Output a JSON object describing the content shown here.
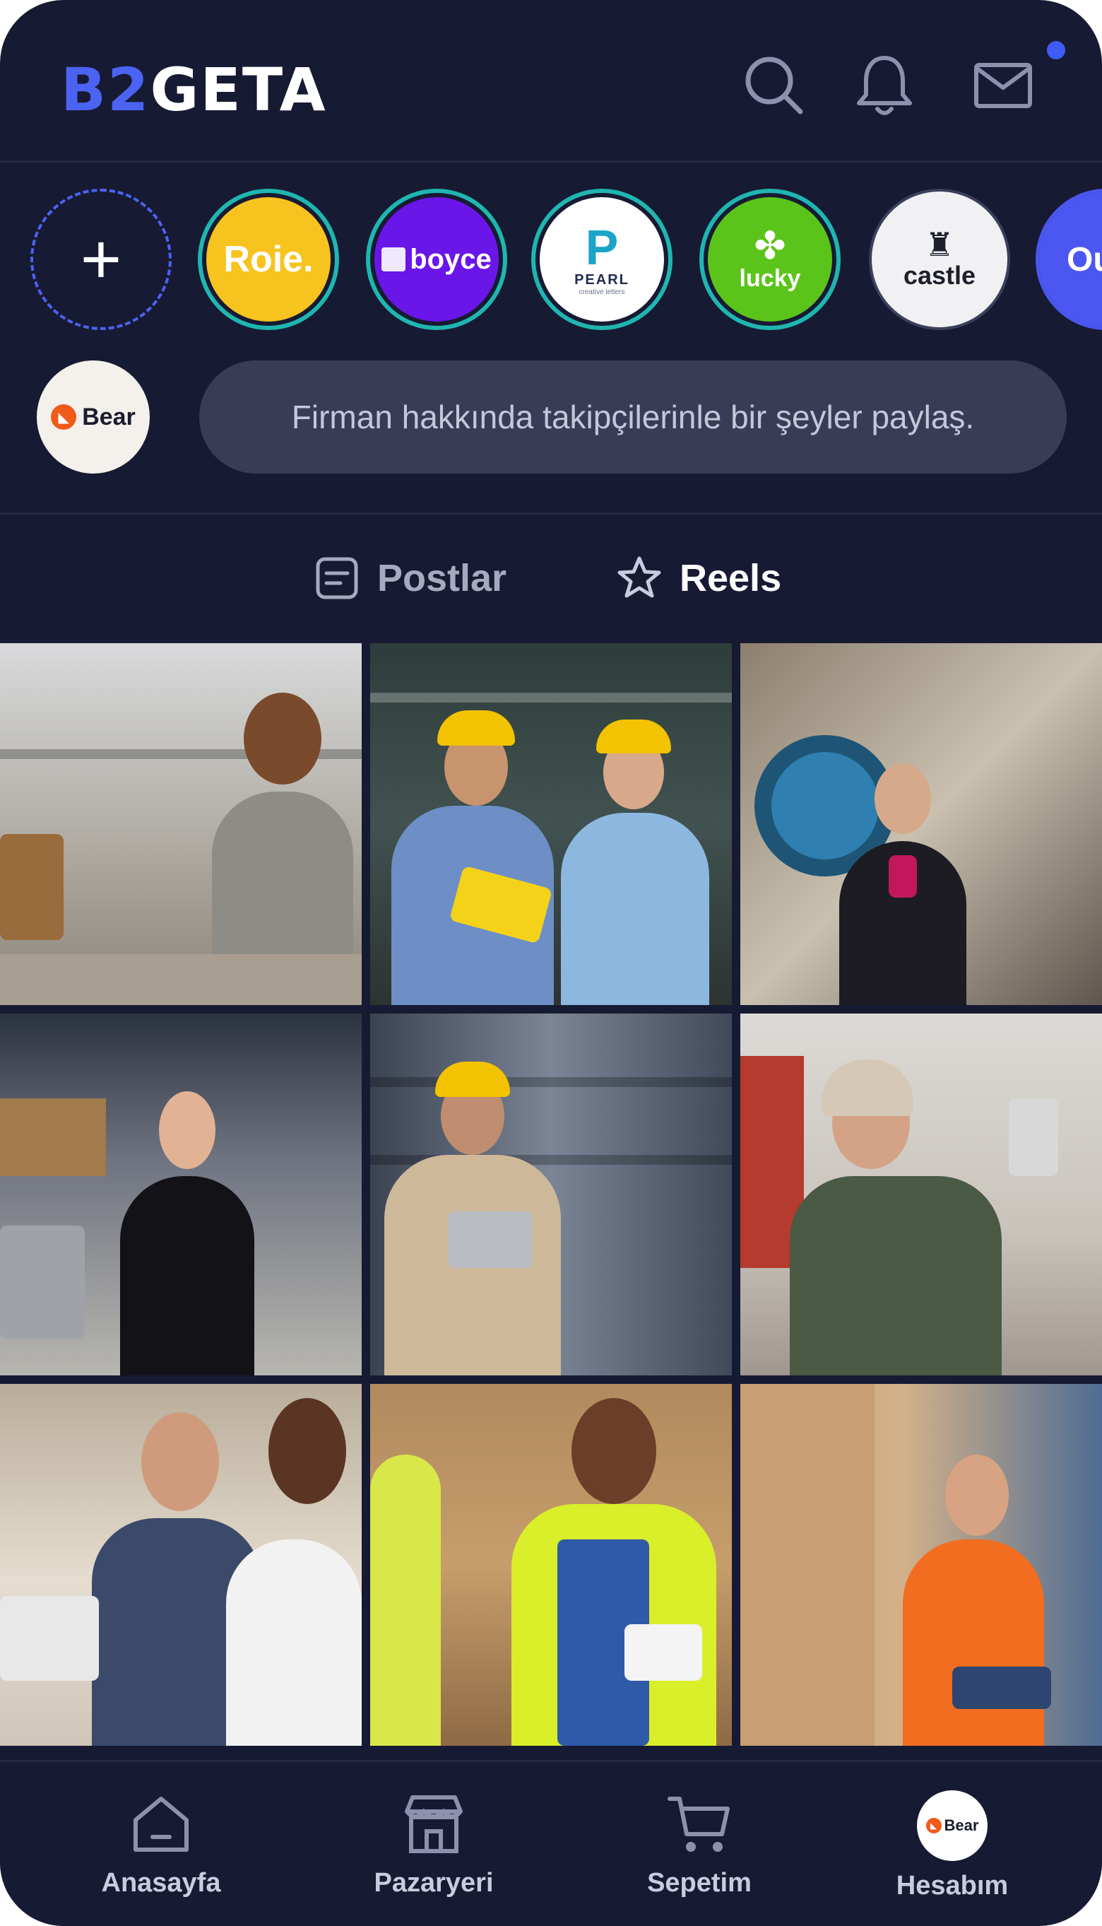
{
  "header": {
    "logo_part1": "B2",
    "logo_part2": "GETA",
    "icons": [
      "search-icon",
      "bell-icon",
      "mail-icon"
    ],
    "has_notification": true,
    "accent": "#4b63f2"
  },
  "stories": [
    {
      "type": "add",
      "icon": "plus-icon"
    },
    {
      "brand": "Roie.",
      "bg": "#f7c31f",
      "fg": "#ffffff"
    },
    {
      "brand": "boyce",
      "bg": "#6a16e8",
      "fg": "#ffffff"
    },
    {
      "brand": "PEARL",
      "sub": "creative letters",
      "bg": "#ffffff",
      "fg": "#1d2b4f"
    },
    {
      "brand": "lucky",
      "bg": "#5bc41a",
      "fg": "#ffffff"
    },
    {
      "brand": "castle",
      "bg": "#f1f1f3",
      "fg": "#1d1f2b"
    },
    {
      "brand": "Ou",
      "bg": "#4b57f0",
      "fg": "#ffffff"
    }
  ],
  "composer": {
    "avatar_label": "Bear",
    "placeholder": "Firman hakkında takipçilerinle bir şeyler paylaş."
  },
  "tabs": [
    {
      "label": "Postlar",
      "icon": "post-icon",
      "active": false
    },
    {
      "label": "Reels",
      "icon": "star-icon",
      "active": true
    }
  ],
  "reels": [
    {
      "desc": "worker-smiling-warehouse"
    },
    {
      "desc": "two-engineers-hard-hats"
    },
    {
      "desc": "woman-industrial-machine"
    },
    {
      "desc": "businesswoman-warehouse"
    },
    {
      "desc": "engineer-tablet-hard-hat"
    },
    {
      "desc": "man-beanie-tablet"
    },
    {
      "desc": "businessmen-meeting"
    },
    {
      "desc": "worker-safety-vest-tablet"
    },
    {
      "desc": "woman-scanning-boxes"
    }
  ],
  "bottom_nav": [
    {
      "label": "Anasayfa",
      "icon": "home-icon"
    },
    {
      "label": "Pazaryeri",
      "icon": "store-icon"
    },
    {
      "label": "Sepetim",
      "icon": "cart-icon"
    },
    {
      "label": "Hesabım",
      "icon": "avatar",
      "avatar_label": "Bear"
    }
  ]
}
